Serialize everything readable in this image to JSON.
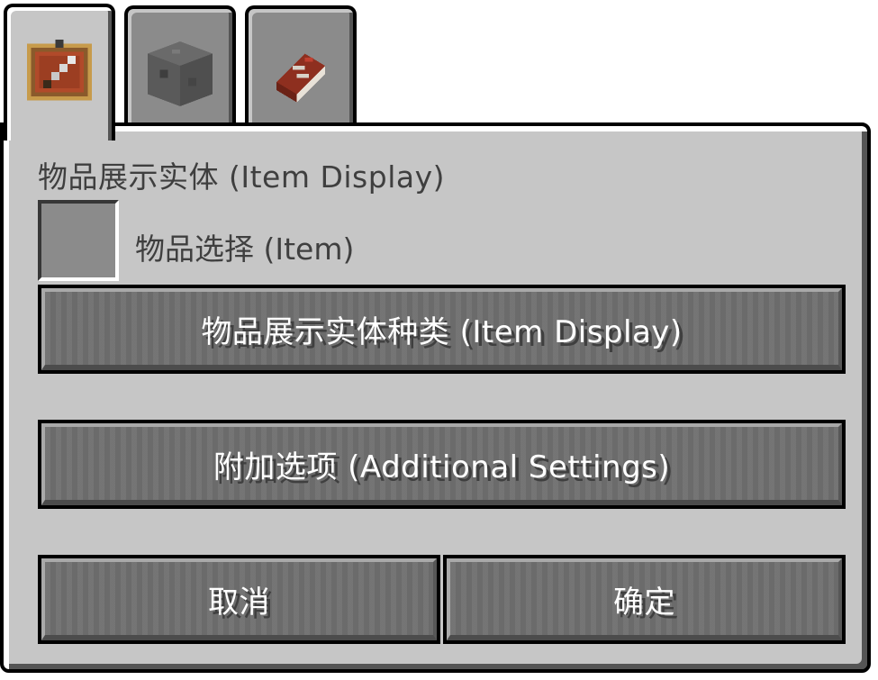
{
  "tabs": [
    {
      "name": "item-frame-tab",
      "icon": "item-frame-icon",
      "active": true
    },
    {
      "name": "block-tab",
      "icon": "stone-block-icon",
      "active": false
    },
    {
      "name": "book-tab",
      "icon": "book-icon",
      "active": false
    }
  ],
  "panel": {
    "title": "物品展示实体 (Item Display)",
    "slot_label": "物品选择 (Item)"
  },
  "buttons": {
    "display_type": "物品展示实体种类 (Item Display)",
    "additional_settings": "附加选项 (Additional Settings)",
    "cancel": "取消",
    "confirm": "确定"
  },
  "colors": {
    "panel_bg": "#c6c6c6",
    "button_bg": "#6f6f6f",
    "text_dark": "#3f3f3f",
    "text_light": "#ffffff"
  }
}
